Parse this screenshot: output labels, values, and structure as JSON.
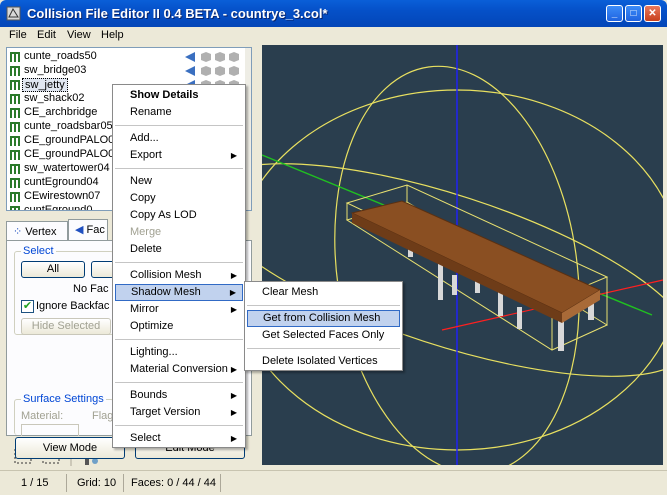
{
  "window": {
    "title": "Collision File Editor II 0.4 BETA - countrye_3.col*",
    "minimize_label": "_",
    "maximize_label": "□",
    "close_label": "✕"
  },
  "menubar": [
    "File",
    "Edit",
    "View",
    "Help"
  ],
  "object_list": [
    {
      "name": "cunte_roads50",
      "icon": "collision-object-icon"
    },
    {
      "name": "sw_bridge03",
      "icon": "collision-object-icon"
    },
    {
      "name": "sw_jetty",
      "icon": "collision-object-icon",
      "selected": true
    },
    {
      "name": "sw_shack02",
      "icon": "collision-object-icon"
    },
    {
      "name": "CE_archbridge",
      "icon": "collision-object-icon"
    },
    {
      "name": "cunte_roadsbar05",
      "icon": "collision-object-icon"
    },
    {
      "name": "CE_groundPALO0",
      "icon": "collision-object-icon"
    },
    {
      "name": "CE_groundPALO0",
      "icon": "collision-object-icon"
    },
    {
      "name": "sw_watertower04",
      "icon": "collision-object-icon"
    },
    {
      "name": "cuntEground04",
      "icon": "collision-object-icon"
    },
    {
      "name": "CEwirestown07",
      "icon": "collision-object-icon"
    },
    {
      "name": "cuntEground0",
      "icon": "collision-object-icon"
    }
  ],
  "tabs": {
    "vertex": "Vertex",
    "faces": "Fac"
  },
  "select_group": {
    "title": "Select",
    "all_button": "All",
    "no_faces_text": "No Fac",
    "ignore_backfaces_label": "Ignore Backfac",
    "ignore_backfaces_checked": true,
    "hide_selected_button": "Hide Selected"
  },
  "surface_group": {
    "title": "Surface Settings",
    "material_label": "Material:",
    "flags_label": "Flag"
  },
  "bottom_buttons": {
    "view_mode": "View Mode",
    "edit_mode": "Edit Mode"
  },
  "context_menu": {
    "items": [
      {
        "label": "Show Details",
        "bold": true
      },
      {
        "label": "Rename"
      },
      {
        "sep": true
      },
      {
        "label": "Add..."
      },
      {
        "label": "Export",
        "submenu": true
      },
      {
        "sep": true
      },
      {
        "label": "New"
      },
      {
        "label": "Copy"
      },
      {
        "label": "Copy As LOD"
      },
      {
        "label": "Merge",
        "disabled": true
      },
      {
        "label": "Delete"
      },
      {
        "sep": true
      },
      {
        "label": "Collision Mesh",
        "submenu": true
      },
      {
        "label": "Shadow Mesh",
        "submenu": true,
        "highlighted": true
      },
      {
        "label": "Mirror",
        "submenu": true
      },
      {
        "label": "Optimize"
      },
      {
        "sep": true
      },
      {
        "label": "Lighting..."
      },
      {
        "label": "Material Conversion",
        "submenu": true
      },
      {
        "sep": true
      },
      {
        "label": "Bounds",
        "submenu": true
      },
      {
        "label": "Target Version",
        "submenu": true
      },
      {
        "sep": true
      },
      {
        "label": "Select",
        "submenu": true
      }
    ]
  },
  "submenu": {
    "items": [
      {
        "label": "Clear Mesh"
      },
      {
        "sep": true
      },
      {
        "label": "Get from Collision Mesh",
        "highlighted": true
      },
      {
        "label": "Get Selected Faces Only"
      },
      {
        "sep": true
      },
      {
        "label": "Delete Isolated Vertices"
      }
    ]
  },
  "statusbar": {
    "position": "1 / 15",
    "grid": "Grid: 10",
    "faces": "Faces: 0 / 44 / 44"
  },
  "colors": {
    "viewport_bg": "#2a3e4e",
    "highlight": "#c1d2ee",
    "title_bar": "#0550c8"
  }
}
